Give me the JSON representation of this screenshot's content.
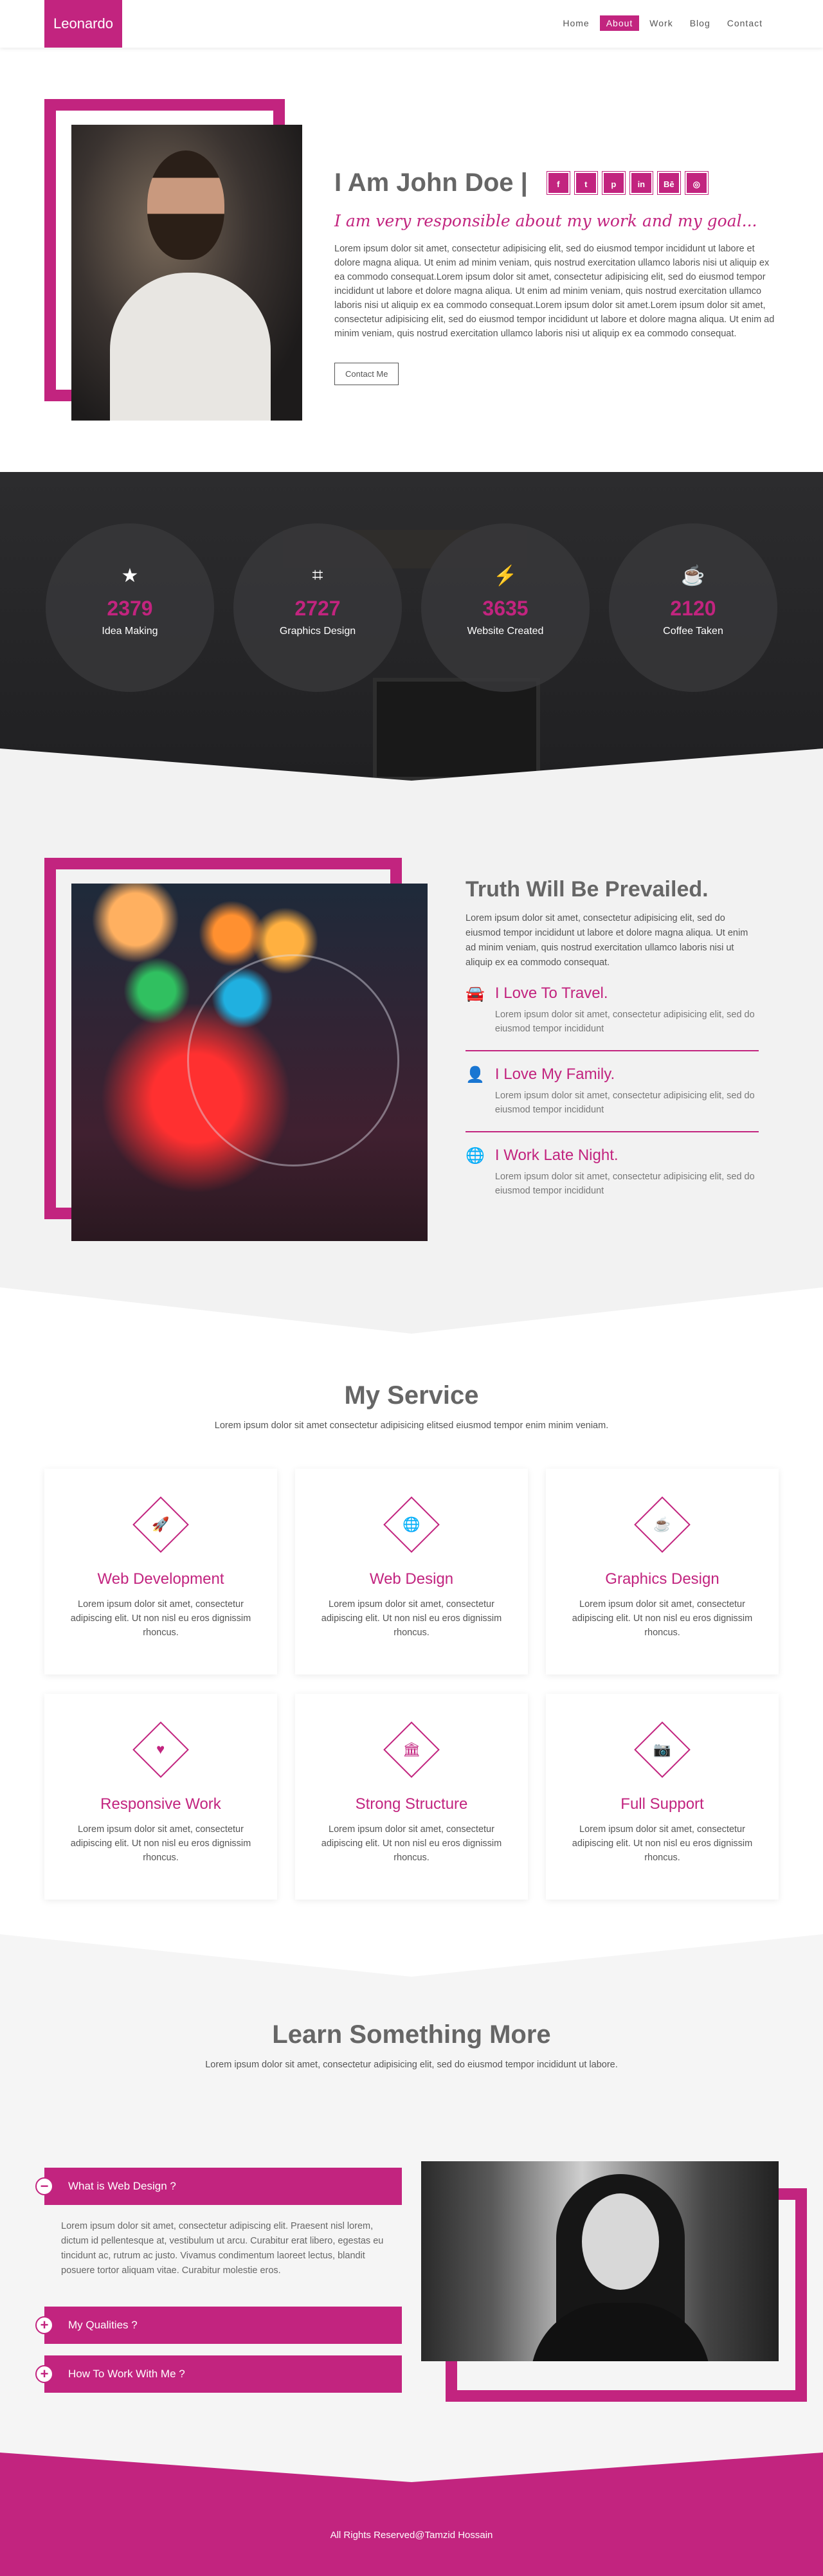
{
  "nav": {
    "logo": "Leonardo",
    "items": [
      {
        "label": "Home",
        "active": false
      },
      {
        "label": "About",
        "active": true
      },
      {
        "label": "Work",
        "active": false
      },
      {
        "label": "Blog",
        "active": false
      },
      {
        "label": "Contact",
        "active": false
      }
    ]
  },
  "about": {
    "name": "I Am John Doe |",
    "socials": [
      "facebook-icon",
      "twitter-icon",
      "pinterest-icon",
      "linkedin-icon",
      "behance-icon",
      "instagram-icon"
    ],
    "social_glyphs": [
      "f",
      "t",
      "p",
      "in",
      "Bē",
      "◎"
    ],
    "tagline": "I am very responsible about my work and my goal...",
    "paragraph": "Lorem ipsum dolor sit amet, consectetur adipisicing elit, sed do eiusmod tempor incididunt ut labore et dolore magna aliqua. Ut enim ad minim veniam, quis nostrud exercitation ullamco laboris nisi ut aliquip ex ea commodo consequat.Lorem ipsum dolor sit amet, consectetur adipisicing elit, sed do eiusmod tempor incididunt ut labore et dolore magna aliqua. Ut enim ad minim veniam, quis nostrud exercitation ullamco laboris nisi ut aliquip ex ea commodo consequat.Lorem ipsum dolor sit amet.Lorem ipsum dolor sit amet, consectetur adipisicing elit, sed do eiusmod tempor incididunt ut labore et dolore magna aliqua. Ut enim ad minim veniam, quis nostrud exercitation ullamco laboris nisi ut aliquip ex ea commodo consequat.",
    "button": "Contact Me"
  },
  "stats": [
    {
      "icon": "star-icon",
      "glyph": "★",
      "number": "2379",
      "label": "Idea Making"
    },
    {
      "icon": "crop-icon",
      "glyph": "⌗",
      "number": "2727",
      "label": "Graphics Design"
    },
    {
      "icon": "bolt-icon",
      "glyph": "⚡",
      "number": "3635",
      "label": "Website Created"
    },
    {
      "icon": "coffee-icon",
      "glyph": "☕",
      "number": "2120",
      "label": "Coffee Taken"
    }
  ],
  "truth": {
    "title": "Truth Will Be Prevailed.",
    "paragraph": "Lorem ipsum dolor sit amet, consectetur adipisicing elit, sed do eiusmod tempor incididunt ut labore et dolore magna aliqua. Ut enim ad minim veniam, quis nostrud exercitation ullamco laboris nisi ut aliquip ex ea commodo consequat.",
    "features": [
      {
        "icon": "car-icon",
        "glyph": "🚘",
        "title": "I Love To Travel.",
        "text": "Lorem ipsum dolor sit amet, consectetur adipisicing elit, sed do eiusmod tempor incididunt"
      },
      {
        "icon": "user-icon",
        "glyph": "👤",
        "title": "I Love My Family.",
        "text": "Lorem ipsum dolor sit amet, consectetur adipisicing elit, sed do eiusmod tempor incididunt"
      },
      {
        "icon": "globe-icon",
        "glyph": "🌐",
        "title": "I Work Late Night.",
        "text": "Lorem ipsum dolor sit amet, consectetur adipisicing elit, sed do eiusmod tempor incididunt"
      }
    ]
  },
  "service": {
    "title": "My Service",
    "subtitle": "Lorem ipsum dolor sit amet consectetur adipisicing elitsed eiusmod tempor enim minim veniam.",
    "cards": [
      {
        "icon": "rocket-icon",
        "glyph": "🚀",
        "title": "Web Development",
        "text": "Lorem ipsum dolor sit amet, consectetur adipiscing elit. Ut non nisl eu eros dignissim rhoncus."
      },
      {
        "icon": "globe-icon",
        "glyph": "🌐",
        "title": "Web Design",
        "text": "Lorem ipsum dolor sit amet, consectetur adipiscing elit. Ut non nisl eu eros dignissim rhoncus."
      },
      {
        "icon": "coffee-icon",
        "glyph": "☕",
        "title": "Graphics Design",
        "text": "Lorem ipsum dolor sit amet, consectetur adipiscing elit. Ut non nisl eu eros dignissim rhoncus."
      },
      {
        "icon": "heart-icon",
        "glyph": "♥",
        "title": "Responsive Work",
        "text": "Lorem ipsum dolor sit amet, consectetur adipiscing elit. Ut non nisl eu eros dignissim rhoncus."
      },
      {
        "icon": "bank-icon",
        "glyph": "🏛",
        "title": "Strong Structure",
        "text": "Lorem ipsum dolor sit amet, consectetur adipiscing elit. Ut non nisl eu eros dignissim rhoncus."
      },
      {
        "icon": "camera-icon",
        "glyph": "📷",
        "title": "Full Support",
        "text": "Lorem ipsum dolor sit amet, consectetur adipiscing elit. Ut non nisl eu eros dignissim rhoncus."
      }
    ]
  },
  "learn": {
    "title": "Learn Something More",
    "subtitle": "Lorem ipsum dolor sit amet, consectetur adipisicing elit, sed do eiusmod tempor incididunt ut labore.",
    "accordion": [
      {
        "title": "What is Web Design ?",
        "open": true,
        "toggle": "−",
        "body": "Lorem ipsum dolor sit amet, consectetur adipiscing elit. Praesent nisl lorem, dictum id pellentesque at, vestibulum ut arcu. Curabitur erat libero, egestas eu tincidunt ac, rutrum ac justo. Vivamus condimentum laoreet lectus, blandit posuere tortor aliquam vitae. Curabitur molestie eros."
      },
      {
        "title": "My Qualities ?",
        "open": false,
        "toggle": "+",
        "body": ""
      },
      {
        "title": "How To Work With Me ?",
        "open": false,
        "toggle": "+",
        "body": ""
      }
    ]
  },
  "footer": {
    "copyright": "All Rights Reserved@Tamzid Hossain"
  },
  "colors": {
    "accent": "#c2247f",
    "dark": "#2c2c2e",
    "light_bg": "#f2f2f2"
  }
}
